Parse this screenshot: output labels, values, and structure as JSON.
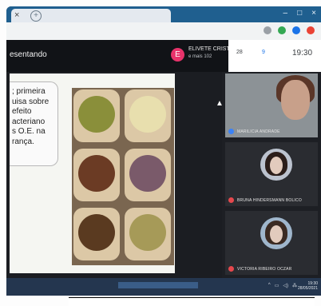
{
  "browser": {
    "tab_close": "×",
    "tab_new": "+",
    "win_controls": [
      "–",
      "□",
      "×"
    ]
  },
  "meet": {
    "presenting": "esentando",
    "presenter": {
      "initial": "E",
      "name": "ELIVETE CRISTI...",
      "more": "e mais 102"
    },
    "people_count": "28",
    "chat_count": "9",
    "clock": "19:30"
  },
  "slide": {
    "lines": [
      "; primeira",
      "uisa sobre",
      "efeito",
      "acteriano",
      "s O.E. na",
      "rança."
    ]
  },
  "participants": [
    {
      "name": "MARILICIA ANDRADE",
      "mic_color": "#3b82f6",
      "type": "video"
    },
    {
      "name": "BRUNA HINDERSMANN BOLICO",
      "mic_color": "#e5484d",
      "type": "avatar"
    },
    {
      "name": "VICTORIA RIBEIRO OCZAR",
      "mic_color": "#e5484d",
      "type": "avatar"
    }
  ],
  "taskbar": {
    "tray": [
      "^",
      "▭",
      "◁)",
      "⁂"
    ],
    "time": "19:30",
    "date": "28/05/2021"
  },
  "colors": {
    "accent_blue": "#1a73e8",
    "presenter_pink": "#e8336b"
  }
}
